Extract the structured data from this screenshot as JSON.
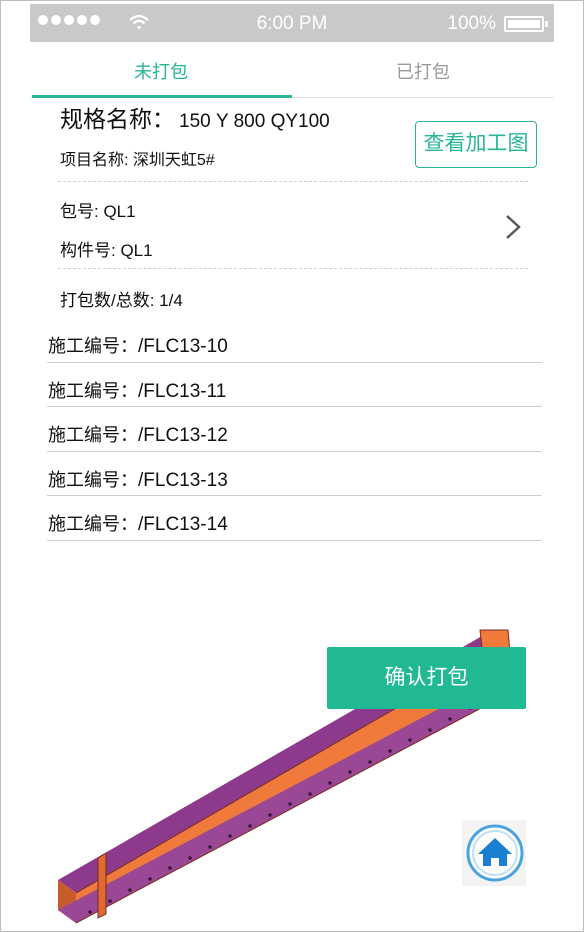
{
  "status_bar": {
    "time": "6:00 PM",
    "battery": "100%"
  },
  "tabs": [
    {
      "label": "未打包",
      "active": true
    },
    {
      "label": "已打包",
      "active": false
    }
  ],
  "spec": {
    "label": "规格名称：",
    "value": "150 Y 800 QY100"
  },
  "project": {
    "label": "项目名称: ",
    "value": "深圳天虹5#"
  },
  "view_drawing_label": "查看加工图",
  "package": {
    "label": "包号: ",
    "value": "QL1"
  },
  "component": {
    "label": "构件号: ",
    "value": "QL1"
  },
  "count": {
    "label": "打包数/总数: ",
    "value": "1/4"
  },
  "construction_items": [
    {
      "label": "施工编号：",
      "value": "/FLC13-10"
    },
    {
      "label": "施工编号：",
      "value": "/FLC13-11"
    },
    {
      "label": "施工编号：",
      "value": "/FLC13-12"
    },
    {
      "label": "施工编号：",
      "value": "/FLC13-13"
    },
    {
      "label": "施工编号：",
      "value": "/FLC13-14"
    }
  ],
  "confirm_label": "确认打包",
  "colors": {
    "accent": "#27b696",
    "button": "#21b994",
    "beam_face": "#f07a3c",
    "beam_flange": "#8e3a8c",
    "home_icon": "#1a7fd0"
  },
  "icons": {
    "chevron": "chevron-right-icon",
    "home": "home-icon"
  }
}
